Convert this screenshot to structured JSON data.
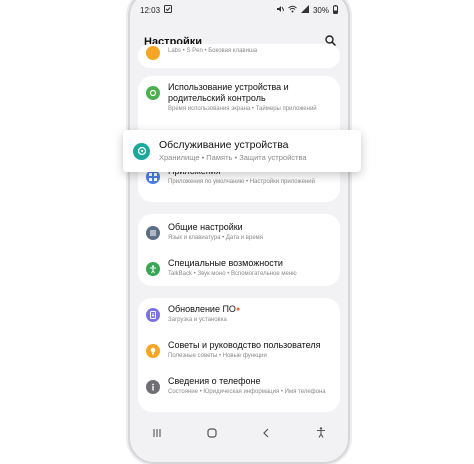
{
  "status_bar": {
    "time": "12:03",
    "battery": "30%"
  },
  "header": {
    "title": "Настройки"
  },
  "top_partial": {
    "subtitle": "Labs • S Pen • Боковая клавиша"
  },
  "items": [
    {
      "title": "Использование устройства и родительский контроль",
      "subtitle": "Время использования экрана • Таймеры приложений",
      "color": "#4caf50"
    },
    {
      "title": "Обслуживание устройства",
      "subtitle": "Хранилище • Память • Защита устройства",
      "color": "#1aa89a"
    },
    {
      "title": "Приложения",
      "subtitle": "Приложения по умолчанию • Настройки приложений",
      "color": "#4a7ee8"
    },
    {
      "title": "Общие настройки",
      "subtitle": "Язык и клавиатура • Дата и время",
      "color": "#5d6f86"
    },
    {
      "title": "Специальные возможности",
      "subtitle": "TalkBack • Звук моно • Вспомогательное меню",
      "color": "#36a854"
    },
    {
      "title": "Обновление ПО",
      "subtitle": "Загрузка и установка",
      "color": "#7a72e0"
    },
    {
      "title": "Советы и руководство пользователя",
      "subtitle": "Полезные советы • Новые функции",
      "color": "#f5a623"
    },
    {
      "title": "Сведения о телефоне",
      "subtitle": "Состояние • Юридическая информация • Имя телефона",
      "color": "#6e6e73"
    }
  ]
}
